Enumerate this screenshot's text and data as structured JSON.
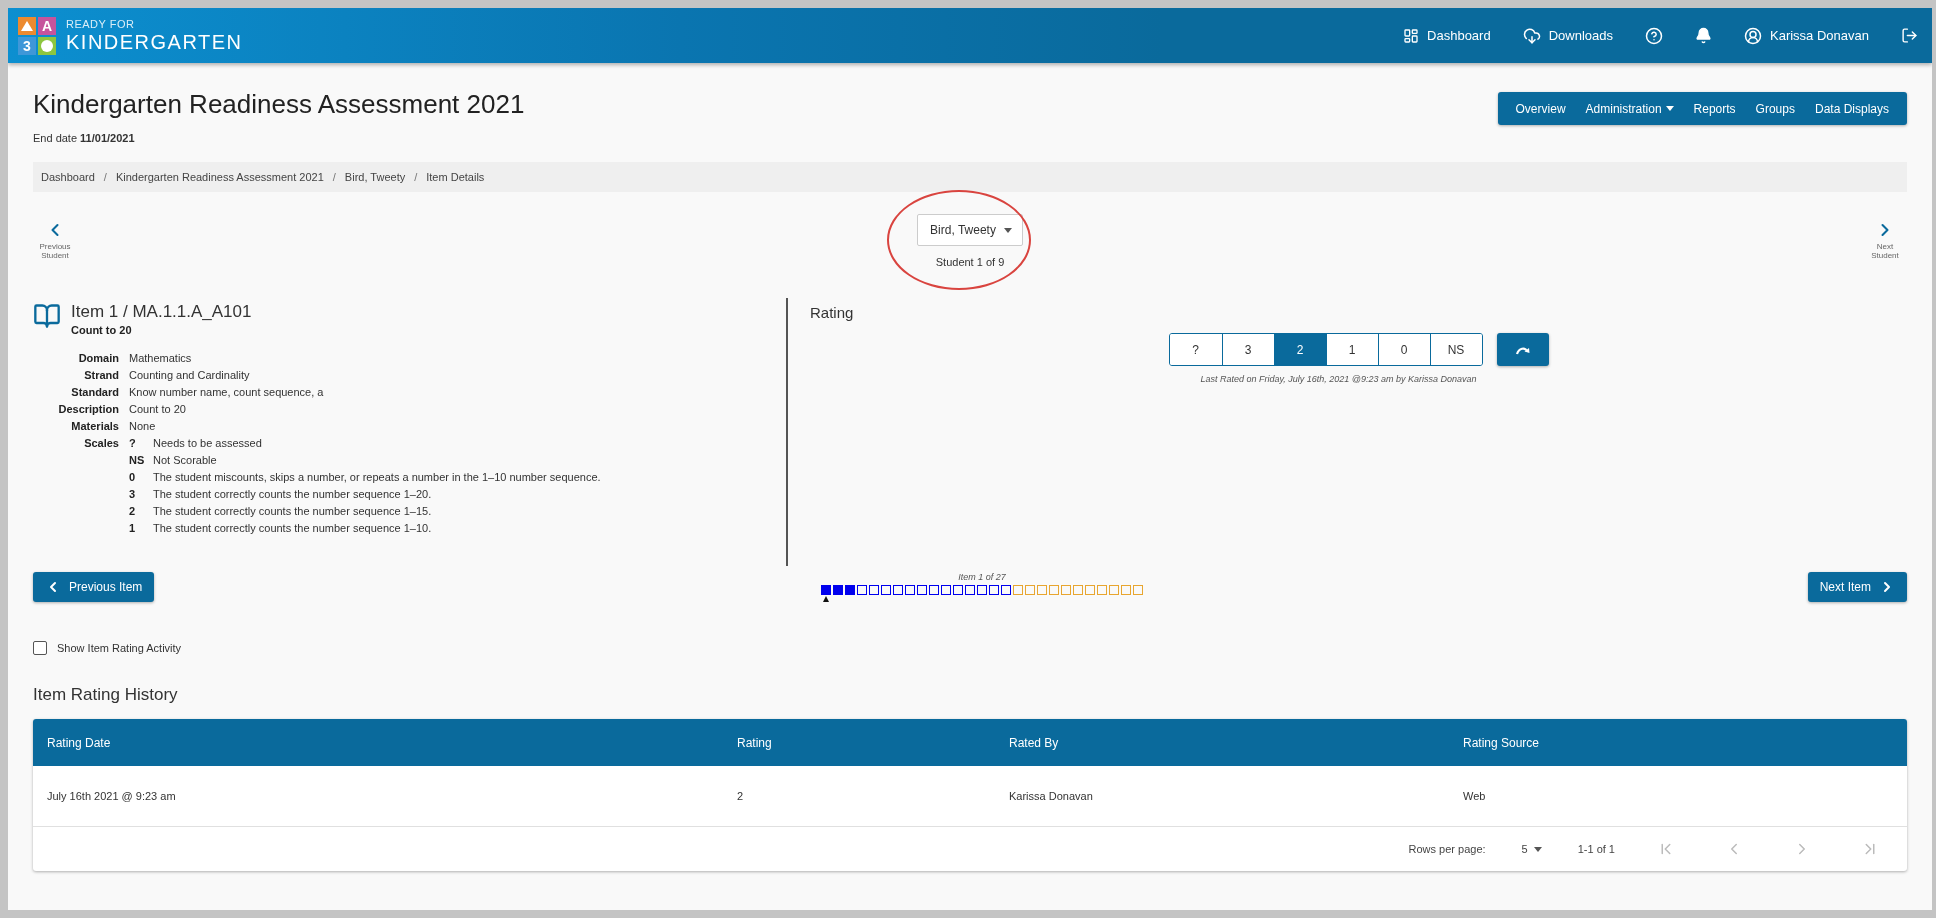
{
  "header": {
    "logo": {
      "tiles": [
        {
          "kind": "triangle",
          "color": "#ec8a2f"
        },
        {
          "kind": "letter",
          "text": "A",
          "color": "#c6549c"
        },
        {
          "kind": "letter",
          "text": "3",
          "color": "#3f97d8"
        },
        {
          "kind": "circle",
          "color": "#8dc63f"
        }
      ],
      "tagline": "READY FOR",
      "name": "KINDERGARTEN"
    },
    "nav": [
      {
        "kind": "dashboard",
        "label": "Dashboard"
      },
      {
        "kind": "download",
        "label": "Downloads"
      },
      {
        "kind": "help"
      },
      {
        "kind": "notifications"
      },
      {
        "kind": "user",
        "label": "Karissa Donavan"
      },
      {
        "kind": "logout"
      }
    ]
  },
  "page": {
    "title": "Kindergarten Readiness Assessment 2021",
    "end_date_label": "End date",
    "end_date": "11/01/2021"
  },
  "menu": [
    {
      "label": "Overview",
      "dropdown": false
    },
    {
      "label": "Administration",
      "dropdown": true
    },
    {
      "label": "Reports",
      "dropdown": false
    },
    {
      "label": "Groups",
      "dropdown": false
    },
    {
      "label": "Data Displays",
      "dropdown": false
    }
  ],
  "breadcrumbs": {
    "separator": "/",
    "items": [
      "Dashboard",
      "Kindergarten Readiness Assessment 2021",
      "Bird, Tweety",
      "Item Details"
    ]
  },
  "student_nav": {
    "previous": "Previous Student",
    "next": "Next Student",
    "student": "Bird, Tweety",
    "counter": "Student 1 of 9",
    "highlighted": true
  },
  "item": {
    "title": "Item 1 / MA.1.1.A_A101",
    "subtitle": "Count to 20",
    "fields": [
      {
        "label": "Domain",
        "value": "Mathematics"
      },
      {
        "label": "Strand",
        "value": "Counting and Cardinality"
      },
      {
        "label": "Standard",
        "value": "Know number name, count sequence, a"
      },
      {
        "label": "Description",
        "value": "Count to 20"
      },
      {
        "label": "Materials",
        "value": "None"
      }
    ],
    "scales_label": "Scales",
    "scales": [
      {
        "code": "?",
        "text": "Needs to be assessed"
      },
      {
        "code": "NS",
        "text": "Not Scorable"
      },
      {
        "code": "0",
        "text": "The student miscounts, skips a number, or repeats a number in the 1–10 number sequence."
      },
      {
        "code": "3",
        "text": "The student correctly counts the number sequence 1–20."
      },
      {
        "code": "2",
        "text": "The student correctly counts the number sequence 1–15."
      },
      {
        "code": "1",
        "text": "The student correctly counts the number sequence 1–10."
      }
    ]
  },
  "rating": {
    "title": "Rating",
    "options": [
      {
        "label": "?",
        "selected": false
      },
      {
        "label": "3",
        "selected": false
      },
      {
        "label": "2",
        "selected": true
      },
      {
        "label": "1",
        "selected": false
      },
      {
        "label": "0",
        "selected": false
      },
      {
        "label": "NS",
        "selected": false
      }
    ],
    "last_rated": "Last Rated on Friday, July 16th, 2021 @9:23 am by Karissa Donavan"
  },
  "item_nav": {
    "previous": "Previous Item",
    "next": "Next Item",
    "counter": "Item 1 of 27",
    "squares": [
      {
        "color": "#0000ee",
        "filled": true,
        "current": true
      },
      {
        "color": "#0000ee",
        "filled": true,
        "current": false
      },
      {
        "color": "#0000ee",
        "filled": true,
        "current": false
      },
      {
        "color": "#0000ee",
        "filled": false,
        "current": false
      },
      {
        "color": "#0000ee",
        "filled": false,
        "current": false
      },
      {
        "color": "#0000ee",
        "filled": false,
        "current": false
      },
      {
        "color": "#0000ee",
        "filled": false,
        "current": false
      },
      {
        "color": "#0000ee",
        "filled": false,
        "current": false
      },
      {
        "color": "#0000ee",
        "filled": false,
        "current": false
      },
      {
        "color": "#0000ee",
        "filled": false,
        "current": false
      },
      {
        "color": "#0000ee",
        "filled": false,
        "current": false
      },
      {
        "color": "#0000ee",
        "filled": false,
        "current": false
      },
      {
        "color": "#0000ee",
        "filled": false,
        "current": false
      },
      {
        "color": "#0000ee",
        "filled": false,
        "current": false
      },
      {
        "color": "#0000ee",
        "filled": false,
        "current": false
      },
      {
        "color": "#0000ee",
        "filled": false,
        "current": false
      },
      {
        "color": "#e8a630",
        "filled": false,
        "current": false
      },
      {
        "color": "#e8a630",
        "filled": false,
        "current": false
      },
      {
        "color": "#e8a630",
        "filled": false,
        "current": false
      },
      {
        "color": "#e8a630",
        "filled": false,
        "current": false
      },
      {
        "color": "#e8a630",
        "filled": false,
        "current": false
      },
      {
        "color": "#e8a630",
        "filled": false,
        "current": false
      },
      {
        "color": "#e8a630",
        "filled": false,
        "current": false
      },
      {
        "color": "#e8a630",
        "filled": false,
        "current": false
      },
      {
        "color": "#e8a630",
        "filled": false,
        "current": false
      },
      {
        "color": "#e8a630",
        "filled": false,
        "current": false
      },
      {
        "color": "#e8a630",
        "filled": false,
        "current": false
      }
    ]
  },
  "show_activity": {
    "label": "Show Item Rating Activity",
    "checked": false
  },
  "history": {
    "title": "Item Rating History",
    "columns": [
      "Rating Date",
      "Rating",
      "Rated By",
      "Rating Source"
    ],
    "rows": [
      [
        "July 16th 2021 @ 9:23 am",
        "2",
        "Karissa Donavan",
        "Web"
      ]
    ],
    "pagination": {
      "rows_per_page_label": "Rows per page:",
      "rows_per_page": "5",
      "range": "1-1 of 1"
    }
  }
}
